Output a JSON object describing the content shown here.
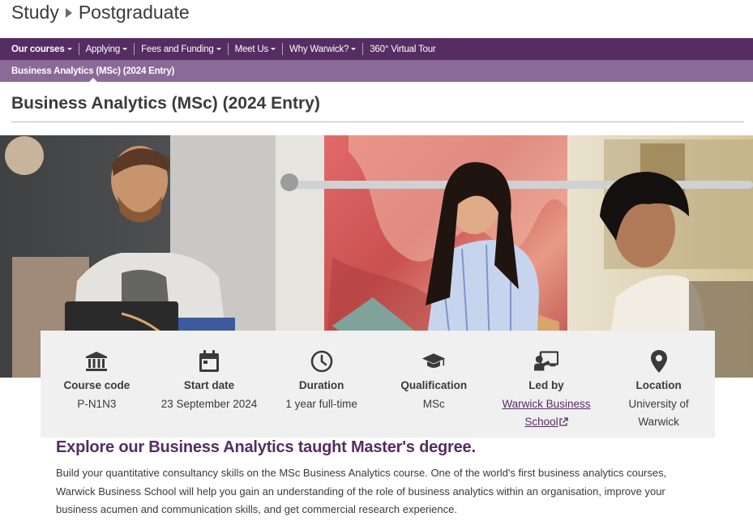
{
  "header": {
    "breadcrumb_root": "Study",
    "breadcrumb_current": "Postgraduate"
  },
  "nav": {
    "items": [
      {
        "label": "Our courses",
        "has_dropdown": true
      },
      {
        "label": "Applying",
        "has_dropdown": true
      },
      {
        "label": "Fees and Funding",
        "has_dropdown": true
      },
      {
        "label": "Meet Us",
        "has_dropdown": true
      },
      {
        "label": "Why Warwick?",
        "has_dropdown": true
      },
      {
        "label": "360° Virtual Tour",
        "has_dropdown": false
      }
    ]
  },
  "subnav": {
    "current": "Business Analytics (MSc) (2024 Entry)"
  },
  "page": {
    "title": "Business Analytics (MSc) (2024 Entry)"
  },
  "info": [
    {
      "icon": "bank-icon",
      "label": "Course code",
      "value": "P-N1N3"
    },
    {
      "icon": "calendar-icon",
      "label": "Start date",
      "value": "23 September 2024"
    },
    {
      "icon": "clock-icon",
      "label": "Duration",
      "value": "1 year full-time"
    },
    {
      "icon": "graduation-cap-icon",
      "label": "Qualification",
      "value": "MSc"
    },
    {
      "icon": "presenter-icon",
      "label": "Led by",
      "value": "Warwick Business School",
      "is_link": true,
      "external": true
    },
    {
      "icon": "map-pin-icon",
      "label": "Location",
      "value": "University of Warwick"
    }
  ],
  "content": {
    "heading": "Explore our Business Analytics taught Master's degree.",
    "intro": "Build your quantitative consultancy skills on the MSc Business Analytics course. One of the world's first business analytics courses, Warwick Business School will help you gain an understanding of the role of business analytics within an organisation, improve your business acumen and communication skills, and get commercial research experience."
  },
  "colors": {
    "brand_purple": "#552d62",
    "subnav_purple": "#8a6a97",
    "panel_grey": "#f0f0f0"
  }
}
